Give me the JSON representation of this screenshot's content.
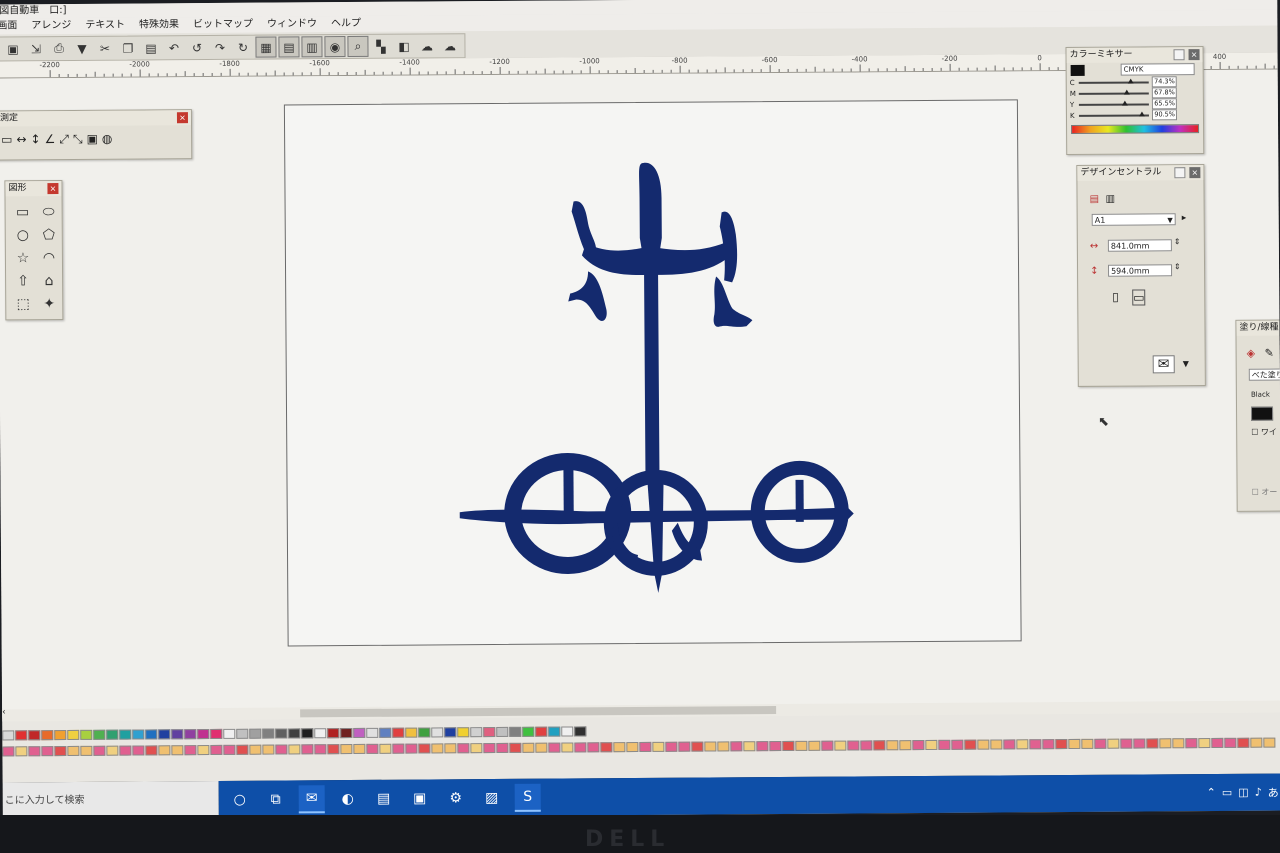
{
  "app": {
    "title": "図自動車　口:]"
  },
  "menu": [
    "画面",
    "アレンジ",
    "テキスト",
    "特殊効果",
    "ビットマップ",
    "ウィンドウ",
    "ヘルプ"
  ],
  "ruler_ticks": [
    "-2200",
    "-2000",
    "-1800",
    "-1600",
    "-1400",
    "-1200",
    "-1000",
    "-800",
    "-600",
    "-400",
    "-200",
    "0",
    "200",
    "400"
  ],
  "panels": {
    "measure": {
      "title": "測定"
    },
    "shapes": {
      "title": "図形"
    },
    "color_mixer": {
      "title": "カラーミキサー",
      "mode": "CMYK",
      "channels": [
        {
          "label": "C",
          "value": "74.3%",
          "level": 0.743
        },
        {
          "label": "M",
          "value": "67.8%",
          "level": 0.678
        },
        {
          "label": "Y",
          "value": "65.5%",
          "level": 0.655
        },
        {
          "label": "K",
          "value": "90.5%",
          "level": 0.905
        }
      ]
    },
    "design_control": {
      "title": "デザインセントラル",
      "paper": "A1",
      "width": "841.0mm",
      "height": "594.0mm"
    },
    "fill": {
      "title": "塗り/線種",
      "fill_type": "べた塗り",
      "color_name": "Black",
      "option1": "ワイ",
      "option2": "オー"
    }
  },
  "artwork": {
    "color": "#142a6e"
  },
  "taskbar": {
    "search_placeholder": "こに入力して検索",
    "ime": "あ"
  },
  "monitor": {
    "brand": "DELL"
  }
}
